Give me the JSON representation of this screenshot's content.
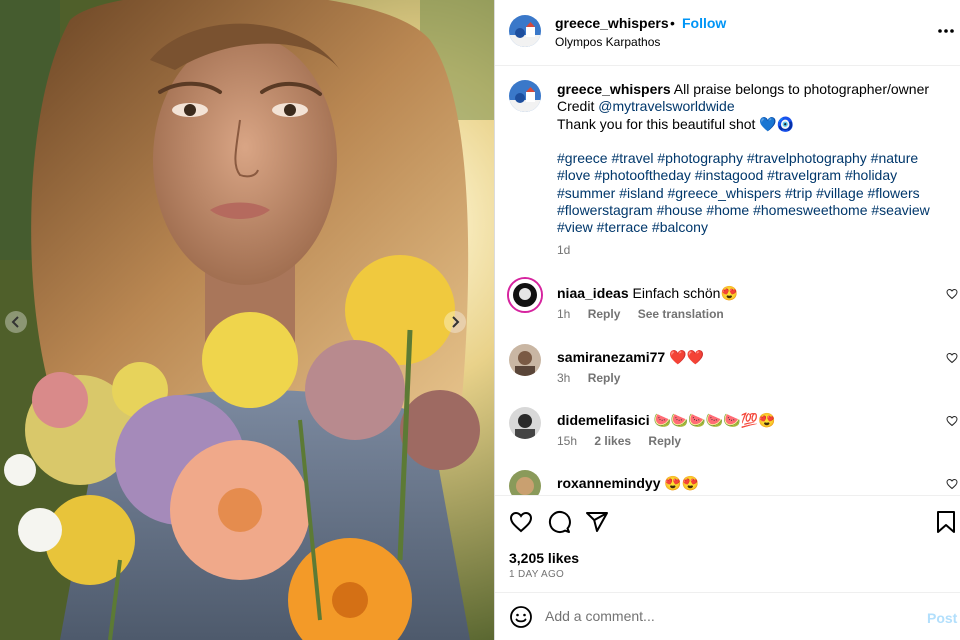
{
  "post": {
    "username": "greece_whispers",
    "dot": "•",
    "follow_label": "Follow",
    "location": "Olympos Karpathos",
    "more_label": "•••"
  },
  "caption": {
    "username": "greece_whispers",
    "line1": "All praise belongs to photographer/owner",
    "credit_prefix": "Credit",
    "credit_handle": "@mytravelsworldwide",
    "line3": "Thank you for this beautiful shot 💙🧿",
    "hashtags": "#greece #travel #photography #travelphotography #nature #love #photooftheday #instagood #travelgram #holiday #summer #island #greece_whispers #trip #village #flowers #flowerstagram #house #home #homesweethome #seaview #view #terrace #balcony",
    "age": "1d"
  },
  "comments": [
    {
      "username": "niaa_ideas",
      "text": "Einfach schön😍",
      "time": "1h",
      "likes": "",
      "reply": "Reply",
      "translate": "See translation"
    },
    {
      "username": "samiranezami77",
      "text": "❤️❤️",
      "time": "3h",
      "likes": "",
      "reply": "Reply",
      "translate": ""
    },
    {
      "username": "didemelifasici",
      "text": "🍉🍉🍉🍉🍉💯😍",
      "time": "15h",
      "likes": "2 likes",
      "reply": "Reply",
      "translate": ""
    },
    {
      "username": "roxannemindyy",
      "text": "😍😍",
      "time": "",
      "likes": "",
      "reply": "",
      "translate": ""
    }
  ],
  "footer": {
    "likes": "3,205 likes",
    "date": "1 DAY AGO",
    "comment_placeholder": "Add a comment...",
    "post_label": "Post"
  },
  "icons": {
    "like": "heart-icon",
    "comment": "comment-icon",
    "share": "share-icon",
    "save": "bookmark-icon",
    "emoji": "emoji-icon",
    "prev": "chevron-left-icon",
    "next": "chevron-right-icon"
  },
  "colors": {
    "follow": "#0095f6",
    "link": "#00376b",
    "muted": "#737373",
    "post_disabled": "#b2dffc"
  }
}
